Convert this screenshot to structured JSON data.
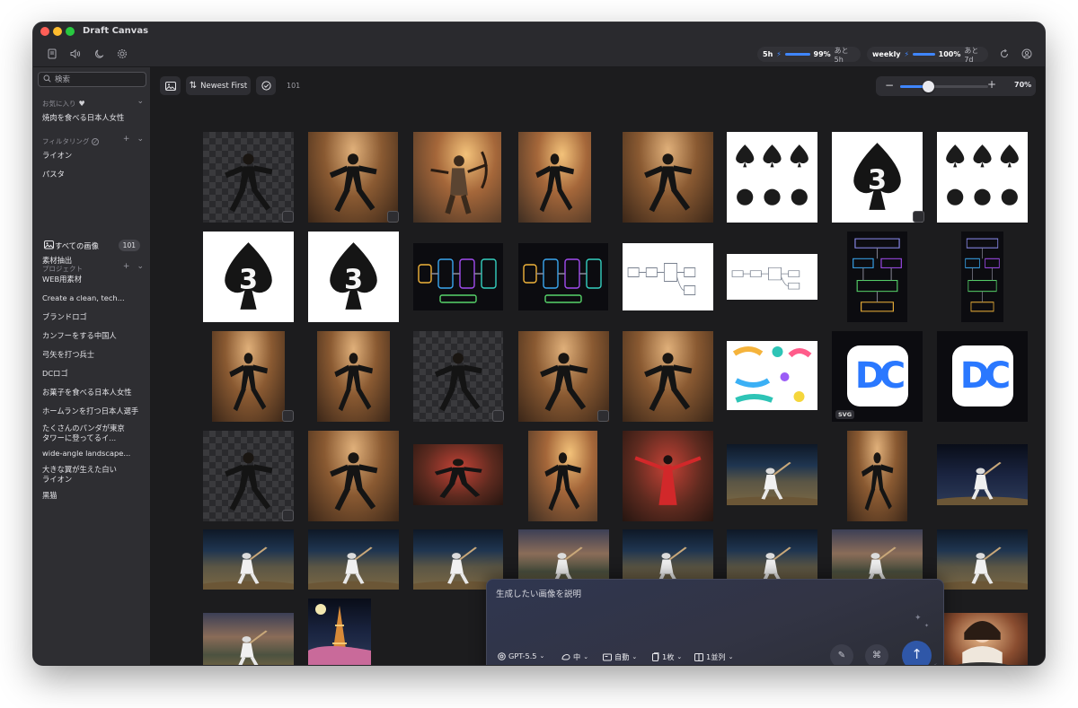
{
  "window": {
    "title": "Draft Canvas"
  },
  "toolbar": {
    "icons": [
      "sidebar-panel-icon",
      "speaker-icon",
      "moon-icon",
      "gear-icon"
    ],
    "usage_5h": {
      "label": "5h",
      "percent_text": "99%",
      "reset": "あと 5h",
      "level": 0.99
    },
    "usage_weekly": {
      "label": "weekly",
      "percent_text": "100%",
      "reset": "あと 7d",
      "level": 1.0
    },
    "right_icons": [
      "refresh-icon",
      "account-icon"
    ]
  },
  "sidebar": {
    "search_placeholder": "検索",
    "favorites": {
      "header": "お気に入り",
      "items": [
        "焼肉を食べる日本人女性"
      ]
    },
    "filtering": {
      "header": "フィルタリング",
      "items": [
        "ライオン",
        "パスタ"
      ]
    },
    "all_images": {
      "label": "すべての画像",
      "count": "101"
    },
    "projects": {
      "header": "プロジェクト",
      "items": [
        "素材抽出",
        "WEB用素材",
        "Create a clean, tech...",
        "ブランドロゴ",
        "カンフーをする中国人",
        "弓矢を打つ兵士",
        "DCロゴ",
        "お菓子を食べる日本人女性",
        "ホームランを打つ日本人選手",
        "たくさんのパンダが東京\nタワーに登ってるイ...",
        "wide-angle landscape...",
        "大きな翼が生えた白い\nライオン",
        "黒猫"
      ]
    }
  },
  "main": {
    "sort_label": "Newest First",
    "count": "101",
    "zoom": {
      "percent_text": "70%",
      "level": 0.32
    }
  },
  "gallery": {
    "spade_number": "3",
    "spade_caption": "SPADE 3",
    "dc_letters": "DC",
    "svg_badge": "SVG"
  },
  "prompt": {
    "placeholder": "生成したい画像を説明",
    "options": [
      "GPT-5.5",
      "中",
      "自動",
      "1枚",
      "1並列"
    ]
  },
  "colors": {
    "accent": "#3f86ff",
    "send": "#2f57a8"
  }
}
